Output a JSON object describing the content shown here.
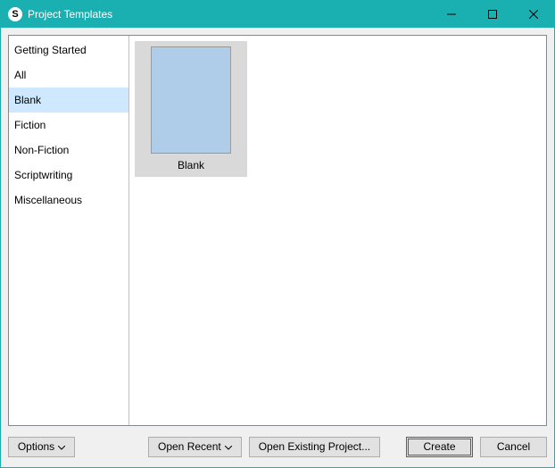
{
  "window": {
    "title": "Project Templates",
    "app_icon_letter": "S"
  },
  "sidebar": {
    "items": [
      {
        "label": "Getting Started",
        "selected": false
      },
      {
        "label": "All",
        "selected": false
      },
      {
        "label": "Blank",
        "selected": true
      },
      {
        "label": "Fiction",
        "selected": false
      },
      {
        "label": "Non-Fiction",
        "selected": false
      },
      {
        "label": "Scriptwriting",
        "selected": false
      },
      {
        "label": "Miscellaneous",
        "selected": false
      }
    ]
  },
  "gallery": {
    "templates": [
      {
        "label": "Blank"
      }
    ]
  },
  "buttons": {
    "options": "Options",
    "open_recent": "Open Recent",
    "open_existing": "Open Existing Project...",
    "create": "Create",
    "cancel": "Cancel"
  }
}
